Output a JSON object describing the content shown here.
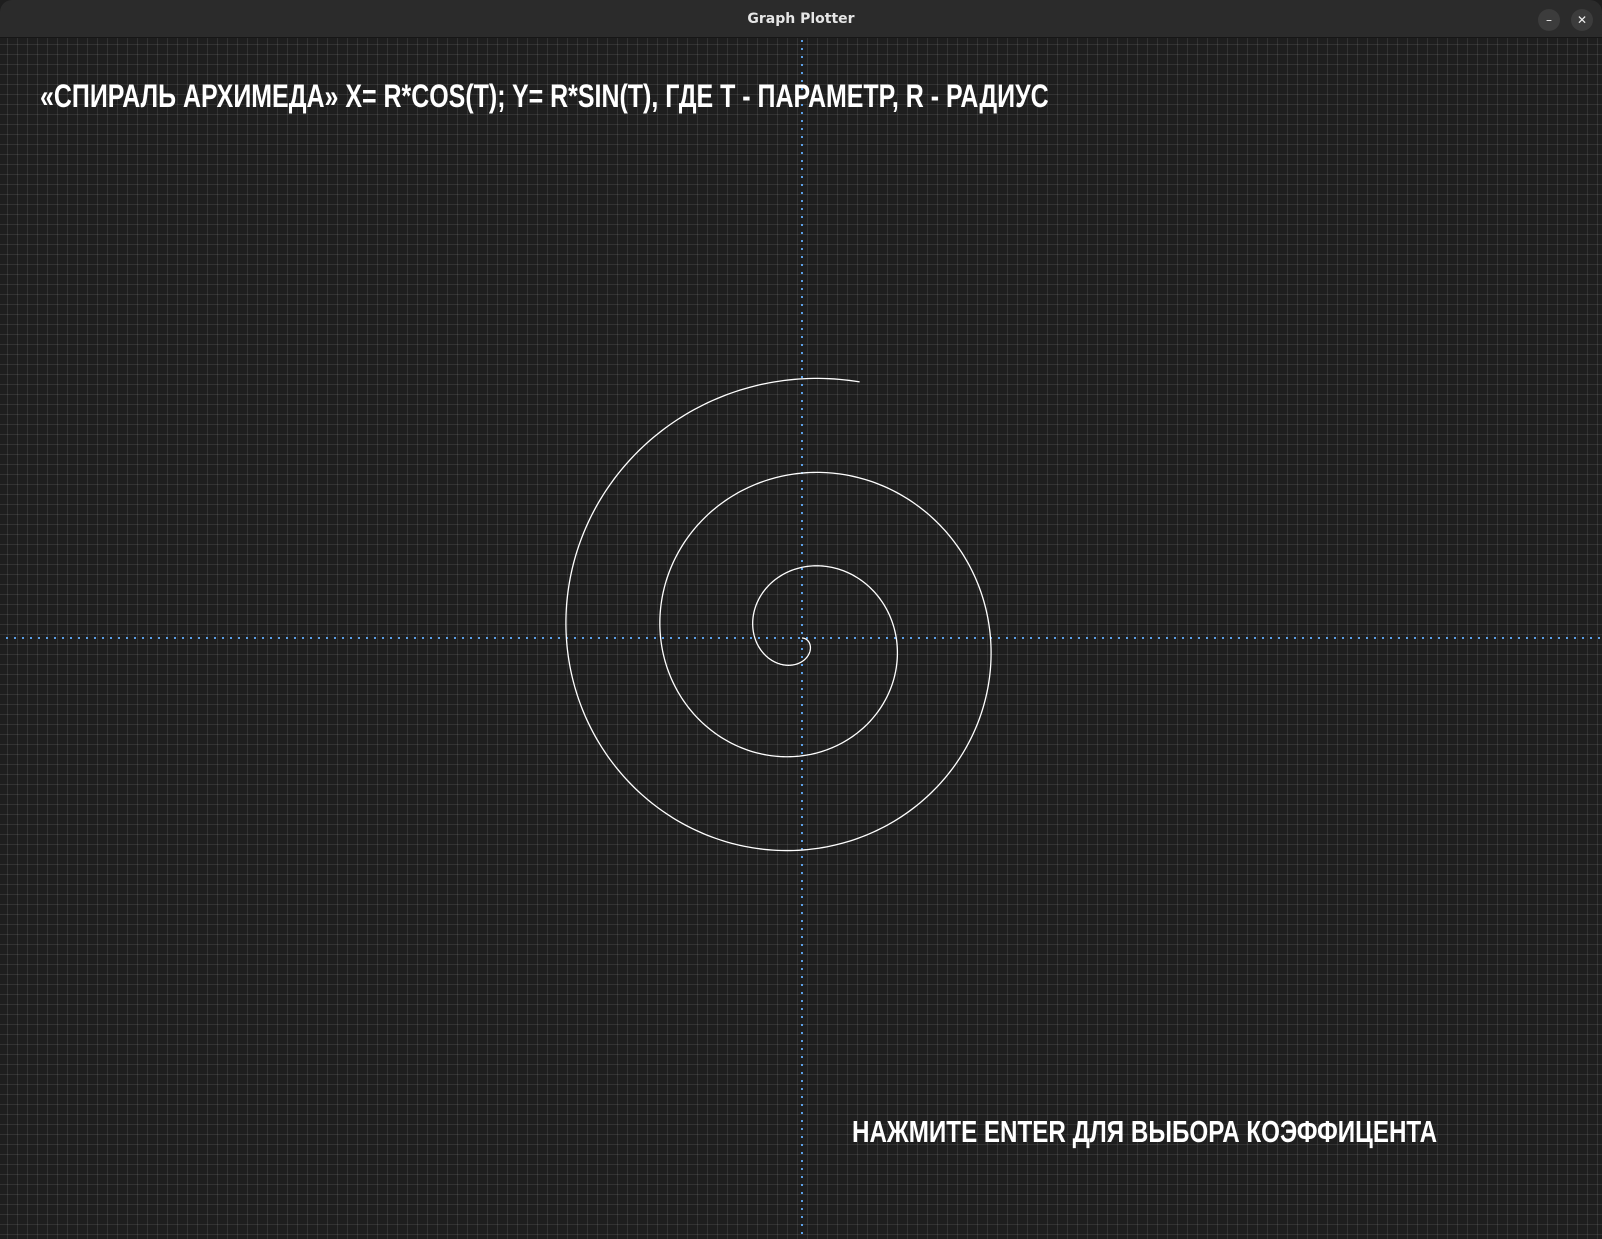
{
  "window": {
    "title": "Graph Plotter",
    "minimize_glyph": "–",
    "close_glyph": "✕"
  },
  "plot": {
    "formula_text": "«Спираль Архимеда» x= r*cos(t); y= r*sin(t), где t - параметр, r - радиус",
    "hint_text": "Нажмите Enter для выбора коэффицента"
  },
  "colors": {
    "background": "#1e1e1e",
    "grid": "#3a3a3a",
    "axis": "#4a90d9",
    "curve": "#ffffff",
    "text": "#ffffff"
  },
  "chart_data": {
    "type": "line",
    "curve": "archimedean spiral",
    "equation": "x = r*cos(t); y = r*sin(t)",
    "r_per_radian": 1,
    "t_range": [
      0,
      17.5
    ],
    "grid": true,
    "axes_style": "dotted"
  }
}
